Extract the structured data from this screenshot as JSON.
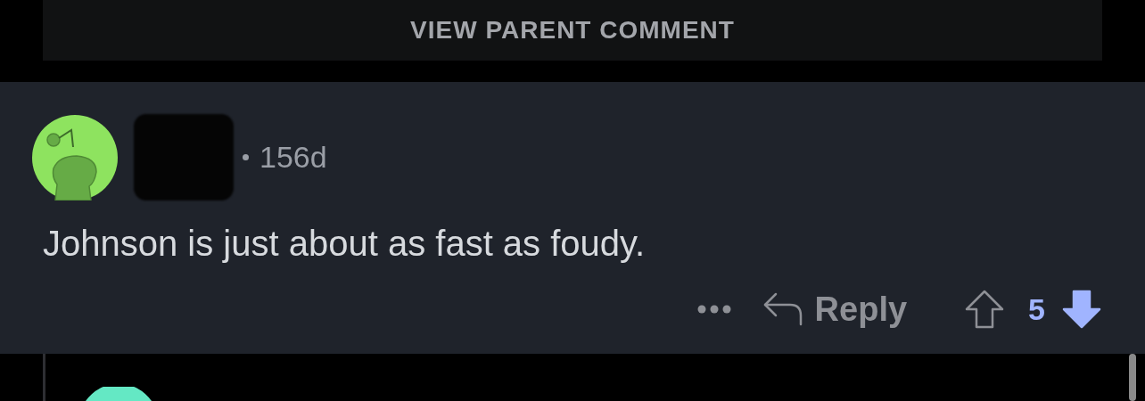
{
  "parent_link": {
    "label": "VIEW PARENT COMMENT"
  },
  "comment": {
    "age": "156d",
    "body": "Johnson is just about as fast as foudy.",
    "reply_label": "Reply",
    "score": "5",
    "upvoted": false,
    "downvoted": true
  }
}
